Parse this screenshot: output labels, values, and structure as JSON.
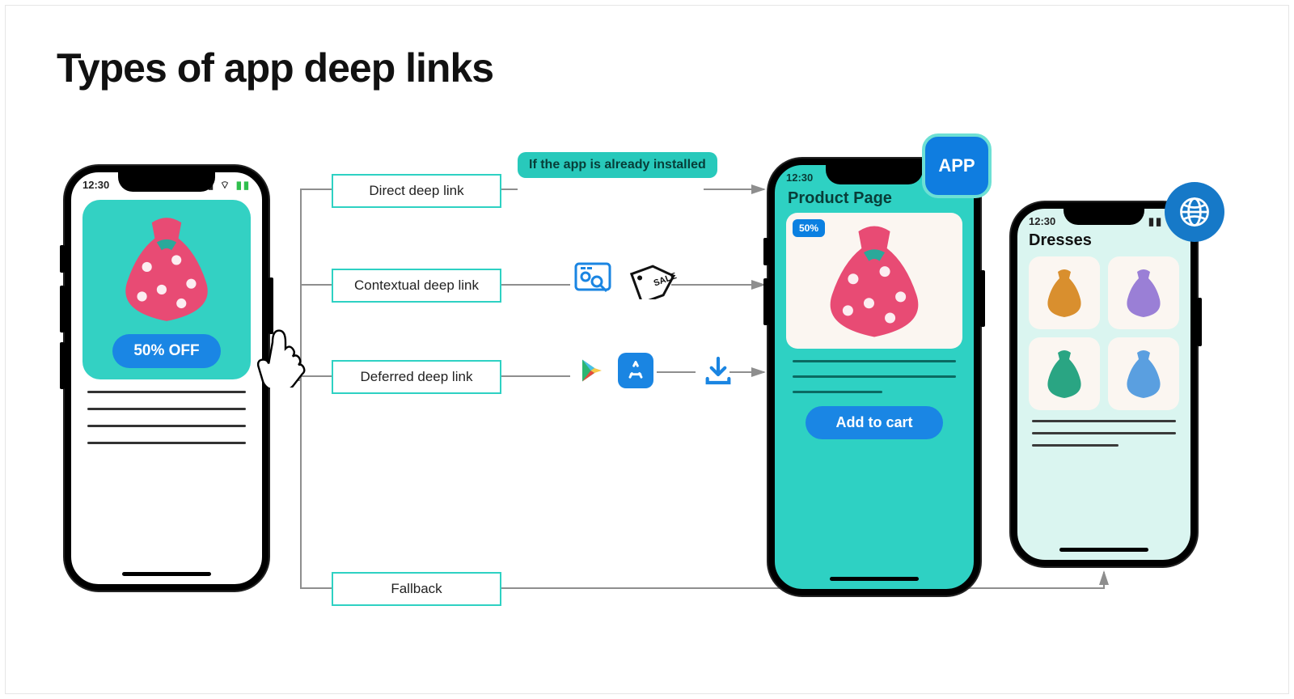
{
  "title": "Types of app deep links",
  "note": "If the app is already installed",
  "links": {
    "direct": "Direct deep link",
    "contextual": "Contextual deep link",
    "deferred": "Deferred deep link",
    "fallback": "Fallback"
  },
  "source_phone": {
    "time": "12:30",
    "offer_label": "50% OFF"
  },
  "app_phone": {
    "time": "12:30",
    "page_title": "Product Page",
    "discount_badge": "50%",
    "cta": "Add to cart",
    "badge_label": "APP"
  },
  "web_phone": {
    "time": "12:30",
    "page_title": "Dresses"
  },
  "icons": {
    "contextual": "search-analytics + sale-tag",
    "deferred": "play-store + app-store + download"
  }
}
